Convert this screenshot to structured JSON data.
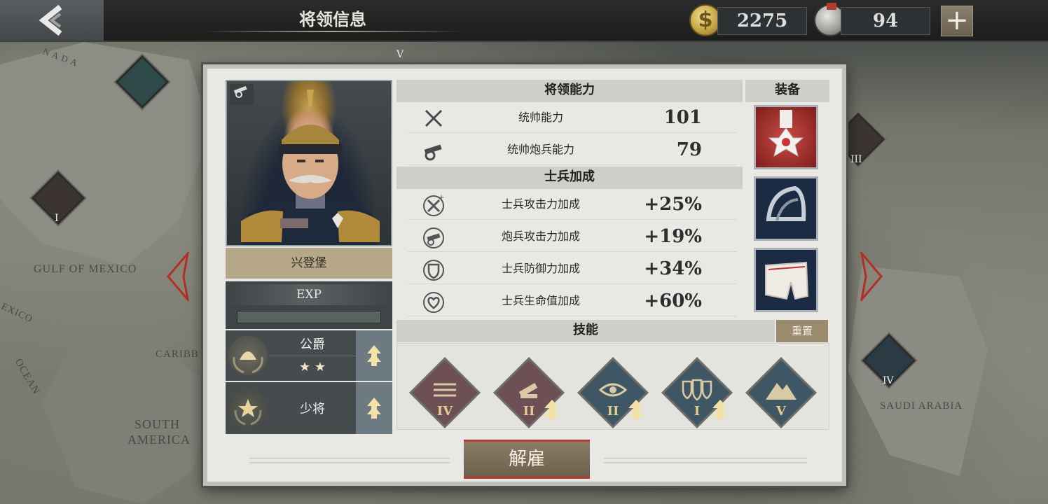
{
  "topbar": {
    "title": "将领信息",
    "gold": "2275",
    "medals": "94",
    "plus": "+"
  },
  "map": {
    "labels": [
      "GULF OF MEXICO",
      "SOUTH",
      "AMERICA",
      "SAUDI ARABIA",
      "CARIBB",
      "EXICO",
      "OCEAN",
      "N A D A"
    ],
    "nodes": [
      "I",
      "III",
      "IV",
      "V"
    ]
  },
  "general": {
    "name": "兴登堡",
    "exp_label": "EXP",
    "exp_progress": 0.0
  },
  "ranks": [
    {
      "name": "公爵",
      "stars": "★ ★"
    },
    {
      "name": "少将"
    }
  ],
  "abilities": {
    "header": "将领能力",
    "rows": [
      {
        "label": "统帅能力",
        "value": "101",
        "icon": "crossed-swords-icon"
      },
      {
        "label": "统帅炮兵能力",
        "value": "79",
        "icon": "cannon-icon"
      }
    ]
  },
  "soldier_bonus": {
    "header": "士兵加成",
    "rows": [
      {
        "label": "士兵攻击力加成",
        "value": "+25%",
        "icon": "sword-plus-icon"
      },
      {
        "label": "炮兵攻击力加成",
        "value": "+19%",
        "icon": "cannon-plus-icon"
      },
      {
        "label": "士兵防御力加成",
        "value": "+34%",
        "icon": "shield-plus-icon"
      },
      {
        "label": "士兵生命值加成",
        "value": "+60%",
        "icon": "heart-plus-icon"
      }
    ]
  },
  "equipment": {
    "header": "装备",
    "items": [
      "medal-icon",
      "helmet-icon",
      "cloth-icon"
    ]
  },
  "skills": {
    "header": "技能",
    "reset": "重置",
    "items": [
      {
        "level": "IV",
        "icon": "arrows-icon",
        "color": "#6e4f55",
        "upgradable": false
      },
      {
        "level": "II",
        "icon": "cannon-skill-icon",
        "color": "#6e4f55",
        "upgradable": true
      },
      {
        "level": "II",
        "icon": "eye-icon",
        "color": "#3f5665",
        "upgradable": true
      },
      {
        "level": "I",
        "icon": "shields-icon",
        "color": "#3f5665",
        "upgradable": true
      },
      {
        "level": "V",
        "icon": "mountain-icon",
        "color": "#3f5665",
        "upgradable": false
      }
    ]
  },
  "actions": {
    "dismiss": "解雇"
  }
}
